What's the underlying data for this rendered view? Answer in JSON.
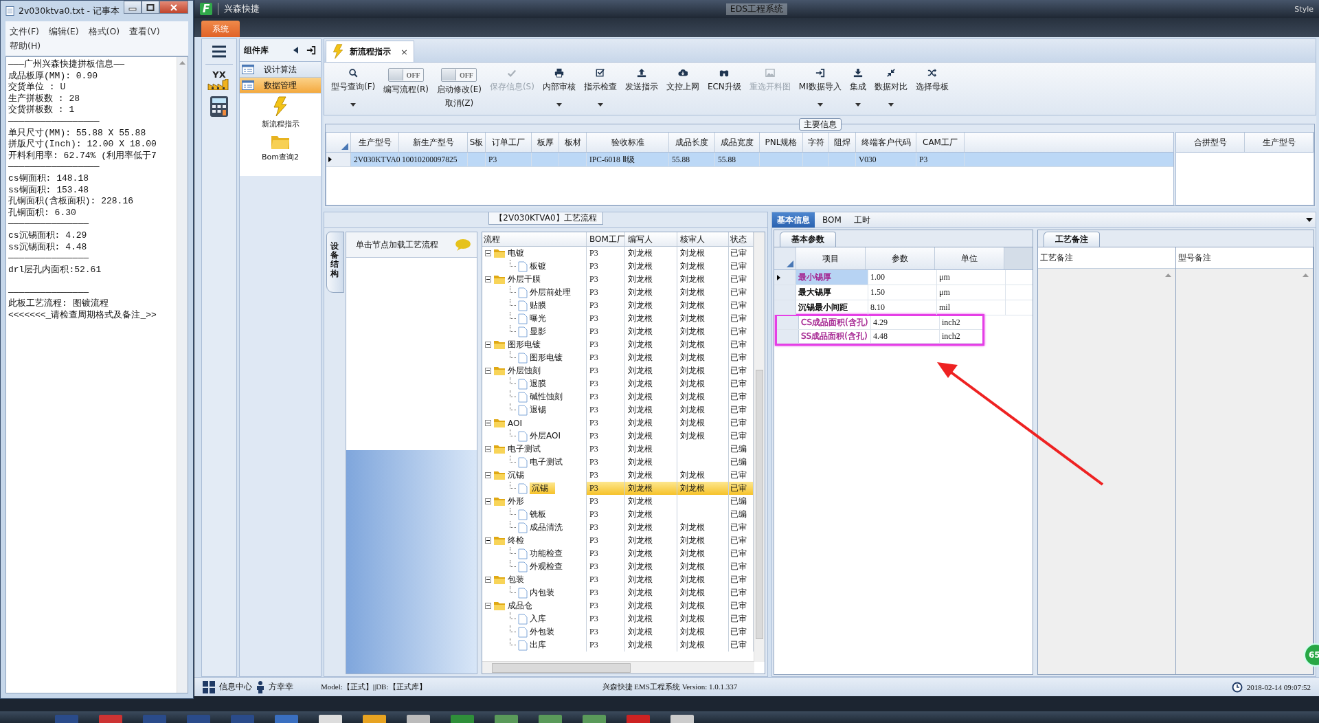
{
  "notepad": {
    "title": "2v030ktva0.txt - 记事本",
    "menu": [
      "文件(F)",
      "编辑(E)",
      "格式(O)",
      "查看(V)",
      "帮助(H)"
    ],
    "lines": [
      {
        "kind": "text",
        "text": "———广州兴森快捷拼板信息——"
      },
      {
        "kind": "text",
        "text": "成品板厚(MM): 0.90"
      },
      {
        "kind": "text",
        "text": "交货单位 : U"
      },
      {
        "kind": "text",
        "text": "生产拼板数 : 28"
      },
      {
        "kind": "text",
        "text": "交货拼板数 : 1"
      },
      {
        "kind": "text",
        "text": "—————————————————"
      },
      {
        "kind": "text",
        "text": "单只尺寸(MM): 55.88 X 55.88"
      },
      {
        "kind": "text",
        "text": "拼版尺寸(Inch): 12.00 X 18.00"
      },
      {
        "kind": "text",
        "text": "开料利用率: 62.74% (利用率低于7"
      },
      {
        "kind": "text",
        "text": "—————————————————"
      },
      {
        "kind": "text",
        "text": "cs铜面积: 148.18"
      },
      {
        "kind": "text",
        "text": "ss铜面积: 153.48"
      },
      {
        "kind": "text",
        "text": "孔铜面积(含板面积): 228.16"
      },
      {
        "kind": "text",
        "text": "孔铜面积: 6.30"
      },
      {
        "kind": "text",
        "text": "———————————————"
      },
      {
        "kind": "text",
        "text": "cs沉锡面积: 4.29"
      },
      {
        "kind": "text",
        "text": "ss沉锡面积: 4.48"
      },
      {
        "kind": "text",
        "text": "———————————————"
      },
      {
        "kind": "text",
        "text": "drl层孔内面积:52.61"
      },
      {
        "kind": "blank"
      },
      {
        "kind": "text",
        "text": "———————————————"
      },
      {
        "kind": "text",
        "text": "此板工艺流程: 图镀流程"
      },
      {
        "kind": "text",
        "text": "<<<<<<<_请检查周期格式及备注_>>"
      }
    ]
  },
  "window": {
    "logo_letter": "F",
    "app_name": "兴森快捷",
    "title": "EDS工程系统",
    "style_label": "Style",
    "ribbon_tabs": [
      {
        "label": "系统",
        "selected": true
      }
    ]
  },
  "rail": {
    "logo_text": "YX"
  },
  "sidebar": {
    "title": "组件库",
    "items": [
      {
        "label": "设计算法",
        "selected": false
      },
      {
        "label": "数据管理",
        "selected": true
      }
    ],
    "shortcuts": [
      {
        "label": "新流程指示",
        "kind": "lightning"
      },
      {
        "label": "Bom查询2",
        "kind": "folder"
      }
    ]
  },
  "document_tabs": [
    {
      "label": "新流程指示",
      "selected": true,
      "close": "×"
    }
  ],
  "toolbar": [
    {
      "kind": "button",
      "label": "型号查询(F)",
      "dropdown": true,
      "disabled": false
    },
    {
      "kind": "toggle",
      "label": "编写流程(R)",
      "on": false,
      "state_text": "OFF"
    },
    {
      "kind": "toggle",
      "label": "启动修改(E)",
      "sublabel": "取消(Z)",
      "on": false,
      "state_text": "OFF"
    },
    {
      "kind": "button",
      "label": "保存信息(S)",
      "dropdown": false,
      "disabled": true
    },
    {
      "kind": "button",
      "label": "内部审核",
      "dropdown": true,
      "disabled": false
    },
    {
      "kind": "button",
      "label": "指示检查",
      "dropdown": true,
      "disabled": false
    },
    {
      "kind": "button",
      "label": "发送指示",
      "dropdown": false,
      "disabled": false
    },
    {
      "kind": "button",
      "label": "文控上网",
      "dropdown": false,
      "disabled": false
    },
    {
      "kind": "button",
      "label": "ECN升级",
      "dropdown": false,
      "disabled": false
    },
    {
      "kind": "button",
      "label": "重选开料图",
      "dropdown": false,
      "disabled": true
    },
    {
      "kind": "button",
      "label": "MI数据导入",
      "dropdown": true,
      "disabled": false
    },
    {
      "kind": "button",
      "label": "集成",
      "dropdown": true,
      "disabled": false
    },
    {
      "kind": "button",
      "label": "数据对比",
      "dropdown": true,
      "disabled": false
    },
    {
      "kind": "button",
      "label": "选择母板",
      "dropdown": false,
      "disabled": false
    }
  ],
  "main_info": {
    "title": "主要信息",
    "columns": [
      "生产型号",
      "新生产型号",
      "S板",
      "订单工厂",
      "板厚",
      "板材",
      "验收标准",
      "成品长度",
      "成品宽度",
      "PNL规格",
      "字符",
      "阻焊",
      "终端客户代码",
      "CAM工厂"
    ],
    "rows": [
      {
        "selected": true,
        "cells": [
          "2V030KTVA0",
          "10010200097825",
          null,
          "P3",
          null,
          null,
          "IPC-6018 Ⅱ级",
          "55.88",
          "55.88",
          null,
          null,
          null,
          "V030",
          "P3"
        ]
      }
    ],
    "side_columns": [
      "合拼型号",
      "生产型号"
    ]
  },
  "process_flow": {
    "title": "【2V030KTVA0】工艺流程",
    "side_tab": "设备结构",
    "hint": "单击节点加载工艺流程",
    "columns": [
      "流程",
      "BOM工厂",
      "编写人",
      "核审人",
      "状态"
    ],
    "tree": [
      {
        "name": "电镀",
        "bom": "P3",
        "writer": "刘龙根",
        "reviewer": "刘龙根",
        "status": "已审",
        "selected": false,
        "expanded": true,
        "children": [
          {
            "name": "板镀",
            "bom": "P3",
            "writer": "刘龙根",
            "reviewer": "刘龙根",
            "status": "已审",
            "selected": false
          }
        ]
      },
      {
        "name": "外层干膜",
        "bom": "P3",
        "writer": "刘龙根",
        "reviewer": "刘龙根",
        "status": "已审",
        "selected": false,
        "expanded": true,
        "children": [
          {
            "name": "外层前处理",
            "bom": "P3",
            "writer": "刘龙根",
            "reviewer": "刘龙根",
            "status": "已审",
            "selected": false
          },
          {
            "name": "贴膜",
            "bom": "P3",
            "writer": "刘龙根",
            "reviewer": "刘龙根",
            "status": "已审",
            "selected": false
          },
          {
            "name": "曝光",
            "bom": "P3",
            "writer": "刘龙根",
            "reviewer": "刘龙根",
            "status": "已审",
            "selected": false
          },
          {
            "name": "显影",
            "bom": "P3",
            "writer": "刘龙根",
            "reviewer": "刘龙根",
            "status": "已审",
            "selected": false
          }
        ]
      },
      {
        "name": "图形电镀",
        "bom": "P3",
        "writer": "刘龙根",
        "reviewer": "刘龙根",
        "status": "已审",
        "selected": false,
        "expanded": true,
        "children": [
          {
            "name": "图形电镀",
            "bom": "P3",
            "writer": "刘龙根",
            "reviewer": "刘龙根",
            "status": "已审",
            "selected": false
          }
        ]
      },
      {
        "name": "外层蚀刻",
        "bom": "P3",
        "writer": "刘龙根",
        "reviewer": "刘龙根",
        "status": "已审",
        "selected": false,
        "expanded": true,
        "children": [
          {
            "name": "退膜",
            "bom": "P3",
            "writer": "刘龙根",
            "reviewer": "刘龙根",
            "status": "已审",
            "selected": false
          },
          {
            "name": "碱性蚀刻",
            "bom": "P3",
            "writer": "刘龙根",
            "reviewer": "刘龙根",
            "status": "已审",
            "selected": false
          },
          {
            "name": "退锡",
            "bom": "P3",
            "writer": "刘龙根",
            "reviewer": "刘龙根",
            "status": "已审",
            "selected": false
          }
        ]
      },
      {
        "name": "AOI",
        "bom": "P3",
        "writer": "刘龙根",
        "reviewer": "刘龙根",
        "status": "已审",
        "selected": false,
        "expanded": true,
        "children": [
          {
            "name": "外层AOI",
            "bom": "P3",
            "writer": "刘龙根",
            "reviewer": "刘龙根",
            "status": "已审",
            "selected": false
          }
        ]
      },
      {
        "name": "电子测试",
        "bom": "P3",
        "writer": "刘龙根",
        "status": "已编",
        "selected": false,
        "expanded": true,
        "children": [
          {
            "name": "电子测试",
            "bom": "P3",
            "writer": "刘龙根",
            "status": "已编",
            "selected": false
          }
        ]
      },
      {
        "name": "沉锡",
        "bom": "P3",
        "writer": "刘龙根",
        "reviewer": "刘龙根",
        "status": "已审",
        "selected": false,
        "expanded": true,
        "children": [
          {
            "name": "沉锡",
            "bom": "P3",
            "writer": "刘龙根",
            "reviewer": "刘龙根",
            "status": "已审",
            "selected": true
          }
        ]
      },
      {
        "name": "外形",
        "bom": "P3",
        "writer": "刘龙根",
        "status": "已编",
        "selected": false,
        "expanded": true,
        "children": [
          {
            "name": "铣板",
            "bom": "P3",
            "writer": "刘龙根",
            "status": "已编",
            "selected": false
          },
          {
            "name": "成品清洗",
            "bom": "P3",
            "writer": "刘龙根",
            "reviewer": "刘龙根",
            "status": "已审",
            "selected": false
          }
        ]
      },
      {
        "name": "终检",
        "bom": "P3",
        "writer": "刘龙根",
        "reviewer": "刘龙根",
        "status": "已审",
        "selected": false,
        "expanded": true,
        "children": [
          {
            "name": "功能检查",
            "bom": "P3",
            "writer": "刘龙根",
            "reviewer": "刘龙根",
            "status": "已审",
            "selected": false
          },
          {
            "name": "外观检查",
            "bom": "P3",
            "writer": "刘龙根",
            "reviewer": "刘龙根",
            "status": "已审",
            "selected": false
          }
        ]
      },
      {
        "name": "包装",
        "bom": "P3",
        "writer": "刘龙根",
        "reviewer": "刘龙根",
        "status": "已审",
        "selected": false,
        "expanded": true,
        "children": [
          {
            "name": "内包装",
            "bom": "P3",
            "writer": "刘龙根",
            "reviewer": "刘龙根",
            "status": "已审",
            "selected": false
          }
        ]
      },
      {
        "name": "成品仓",
        "bom": "P3",
        "writer": "刘龙根",
        "reviewer": "刘龙根",
        "status": "已审",
        "selected": false,
        "expanded": true,
        "children": [
          {
            "name": "入库",
            "bom": "P3",
            "writer": "刘龙根",
            "reviewer": "刘龙根",
            "status": "已审",
            "selected": false
          },
          {
            "name": "外包装",
            "bom": "P3",
            "writer": "刘龙根",
            "reviewer": "刘龙根",
            "status": "已审",
            "selected": false
          },
          {
            "name": "出库",
            "bom": "P3",
            "writer": "刘龙根",
            "reviewer": "刘龙根",
            "status": "已审",
            "selected": false
          }
        ]
      }
    ]
  },
  "detail": {
    "tabs": [
      {
        "label": "基本信息",
        "selected": true
      },
      {
        "label": "BOM",
        "selected": false
      },
      {
        "label": "工时",
        "selected": false
      }
    ],
    "params": {
      "tab": "基本参数",
      "columns": [
        "项目",
        "参数",
        "单位"
      ],
      "rows": [
        {
          "item": "最小锡厚",
          "value": "1.00",
          "unit": "μm",
          "color": "#a3218f",
          "selected": true,
          "highlighted": false
        },
        {
          "item": "最大锡厚",
          "value": "1.50",
          "unit": "μm",
          "color": "#000000",
          "selected": false,
          "highlighted": false
        },
        {
          "item": "沉锡最小间距",
          "value": "8.10",
          "unit": "mil",
          "color": "#000000",
          "selected": false,
          "highlighted": false
        },
        {
          "item": "CS成品面积(含孔)",
          "value": "4.29",
          "unit": "inch2",
          "color": "#a3218f",
          "selected": false,
          "highlighted": true
        },
        {
          "item": "SS成品面积(含孔)",
          "value": "4.48",
          "unit": "inch2",
          "color": "#a3218f",
          "selected": false,
          "highlighted": true
        }
      ]
    },
    "notes": {
      "tab": "工艺备注",
      "columns": [
        "工艺备注",
        "型号备注"
      ]
    }
  },
  "status_bar": {
    "center_label": "信息中心",
    "user": "方幸幸",
    "environment": "Model:【正式】||DB:【正式库】",
    "version": "兴森快捷 EMS工程系统 Version: 1.0.1.337",
    "datetime": "2018-02-14 09:07:52"
  },
  "side_badge": "65"
}
